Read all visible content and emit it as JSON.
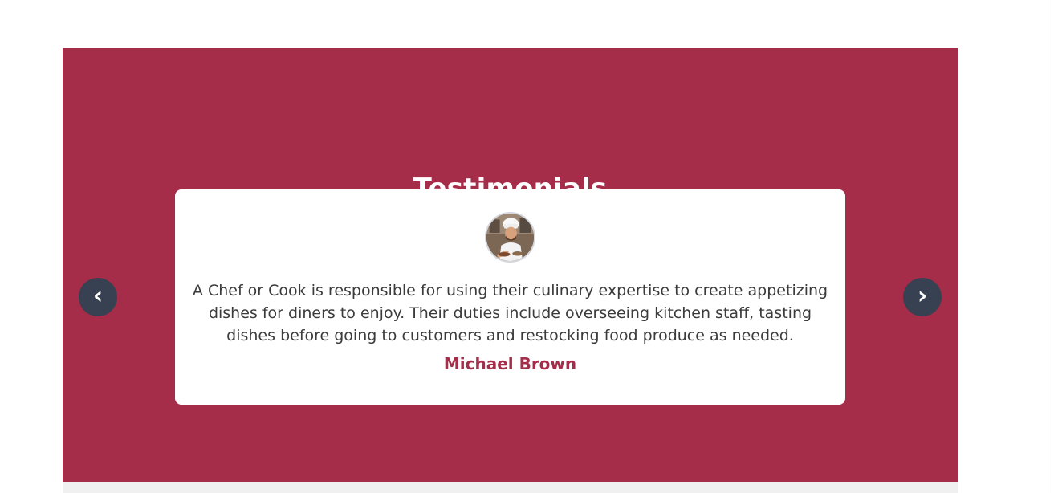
{
  "testimonials": {
    "title": "Testimonials",
    "section_color": "#a52d49",
    "card": {
      "quote": "A Chef or Cook is responsible for using their culinary expertise to create appetizing dishes for diners to enjoy. Their duties include overseeing kitchen staff, tasting dishes before going to customers and restocking food produce as needed.",
      "author": "Michael Brown",
      "avatar_icon": "chef-avatar"
    },
    "controls": {
      "prev_label": "‹",
      "next_label": "›",
      "prev_icon": "chevron-left-icon",
      "next_icon": "chevron-right-icon",
      "button_color": "#374151"
    }
  }
}
